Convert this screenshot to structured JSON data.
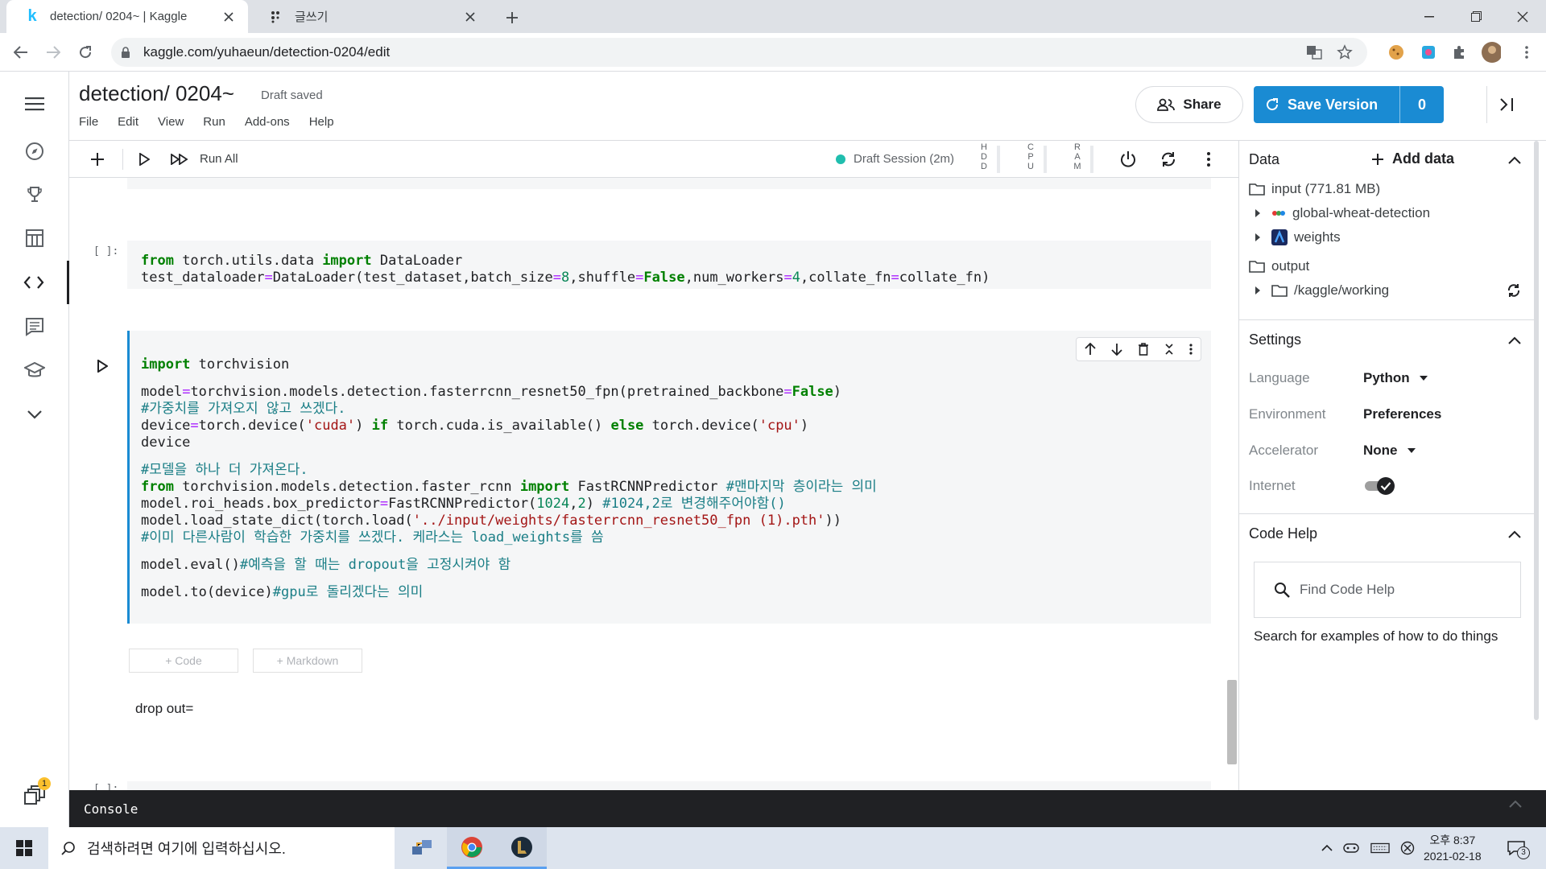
{
  "browser": {
    "tabs": [
      {
        "title": "detection/ 0204~ | Kaggle",
        "active": true
      },
      {
        "title": "글쓰기",
        "active": false
      }
    ],
    "url": "kaggle.com/yuhaeun/detection-0204/edit"
  },
  "notebook": {
    "title": "detection/ 0204~",
    "save_status": "Draft saved",
    "menu": [
      "File",
      "Edit",
      "View",
      "Run",
      "Add-ons",
      "Help"
    ],
    "share_label": "Share",
    "save_version_label": "Save Version",
    "version_count": "0",
    "toolbar": {
      "run_all_label": "Run All",
      "session_label": "Draft Session (2m)",
      "meters": [
        {
          "label": [
            "H",
            "D",
            "D"
          ]
        },
        {
          "label": [
            "C",
            "P",
            "U"
          ]
        },
        {
          "label": [
            "R",
            "A",
            "M"
          ]
        }
      ]
    },
    "cells": {
      "cell1_prompt": "[ ]:",
      "cell2_add_code": "+ Code",
      "cell2_add_markdown": "+ Markdown",
      "markdown_text": "drop out=",
      "cell4_prompt": "[ ]:"
    }
  },
  "data_panel": {
    "title": "Data",
    "add_data_label": "Add data",
    "input_label": "input (771.81 MB)",
    "input_items": [
      "global-wheat-detection",
      "weights"
    ],
    "output_label": "output",
    "output_items": [
      "/kaggle/working"
    ]
  },
  "settings_panel": {
    "title": "Settings",
    "rows": [
      {
        "label": "Language",
        "value": "Python"
      },
      {
        "label": "Environment",
        "value": "Preferences"
      },
      {
        "label": "Accelerator",
        "value": "None"
      },
      {
        "label": "Internet",
        "value": "on"
      }
    ]
  },
  "code_help": {
    "title": "Code Help",
    "search_placeholder": "Find Code Help",
    "description": "Search for examples of how to do things"
  },
  "console": {
    "label": "Console"
  },
  "taskbar": {
    "search_placeholder": "검색하려면 여기에 입력하십시오.",
    "clock_time": "오후 8:37",
    "clock_date": "2021-02-18",
    "notification_count": "3"
  },
  "leftnav_badge": "1",
  "colors": {
    "accent": "#1a8bd3",
    "session_dot": "#20beae",
    "console_bg": "#202124"
  }
}
